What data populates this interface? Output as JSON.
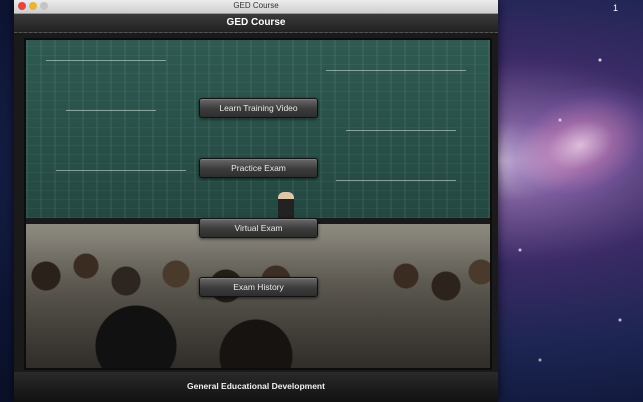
{
  "window": {
    "title": "GED Course"
  },
  "app": {
    "title": "GED Course",
    "footer": "General Educational Development"
  },
  "menu": {
    "buttons": [
      {
        "label": "Learn Training Video"
      },
      {
        "label": "Practice Exam"
      },
      {
        "label": "Virtual Exam"
      },
      {
        "label": "Exam History"
      }
    ]
  },
  "desktop": {
    "menubar_indicator": "1"
  }
}
